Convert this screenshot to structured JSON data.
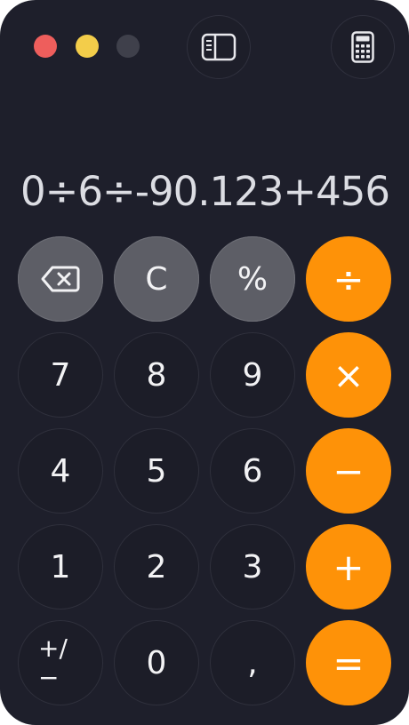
{
  "window": {
    "traffic_lights": [
      {
        "name": "close",
        "color": "#ee5e5c"
      },
      {
        "name": "minimize",
        "color": "#f3cd4a"
      },
      {
        "name": "zoom",
        "color": "#3f404b"
      }
    ],
    "toolbar": {
      "sidebar_icon": "sidebar-icon",
      "calculator_mode_icon": "calculator-icon"
    }
  },
  "display": {
    "expression": "0÷6÷-90.123+456"
  },
  "keys": {
    "backspace": "backspace-icon",
    "clear": "C",
    "percent": "%",
    "divide": "÷",
    "seven": "7",
    "eight": "8",
    "nine": "9",
    "multiply": "×",
    "four": "4",
    "five": "5",
    "six": "6",
    "minus": "−",
    "one": "1",
    "two": "2",
    "three": "3",
    "plus": "+",
    "plus_minus": "+/−",
    "zero": "0",
    "decimal": ",",
    "equals": "="
  },
  "colors": {
    "background": "#1e1f2b",
    "function_key": "#5d5e66",
    "number_key": "#1c1d28",
    "operator_key": "#fe9208",
    "text": "#dcdde3"
  }
}
